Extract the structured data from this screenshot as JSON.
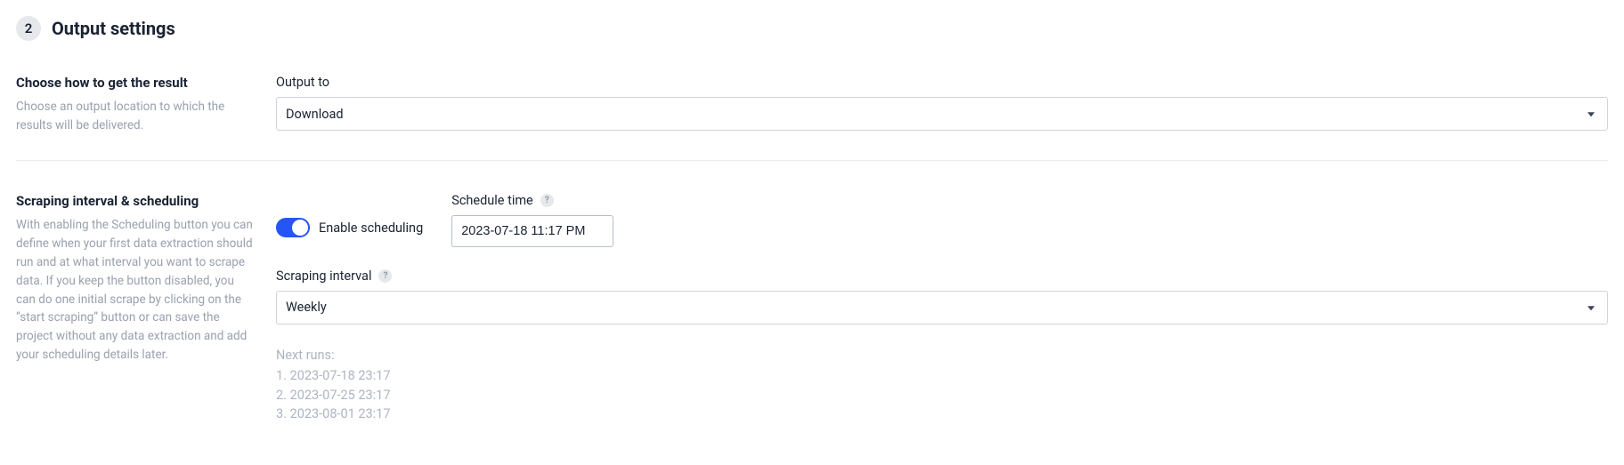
{
  "step": {
    "number": "2",
    "title": "Output settings"
  },
  "output_section": {
    "left_title": "Choose how to get the result",
    "left_desc": "Choose an output location to which the results will be delivered.",
    "field_label": "Output to",
    "selected": "Download"
  },
  "scheduling_section": {
    "left_title": "Scraping interval & scheduling",
    "left_desc": "With enabling the Scheduling button you can define when your first data extraction should run and at what interval you want to scrape data. If you keep the button disabled, you can do one initial scrape by clicking on the “start scraping” button or can save the project without any data extraction and add your scheduling details later.",
    "toggle_label": "Enable scheduling",
    "schedule_time_label": "Schedule time",
    "schedule_time_value": "2023-07-18 11:17 PM",
    "interval_label": "Scraping interval",
    "interval_selected": "Weekly",
    "next_runs_label": "Next runs:",
    "next_runs": [
      "1. 2023-07-18 23:17",
      "2. 2023-07-25 23:17",
      "3. 2023-08-01 23:17"
    ],
    "help_symbol": "?"
  }
}
